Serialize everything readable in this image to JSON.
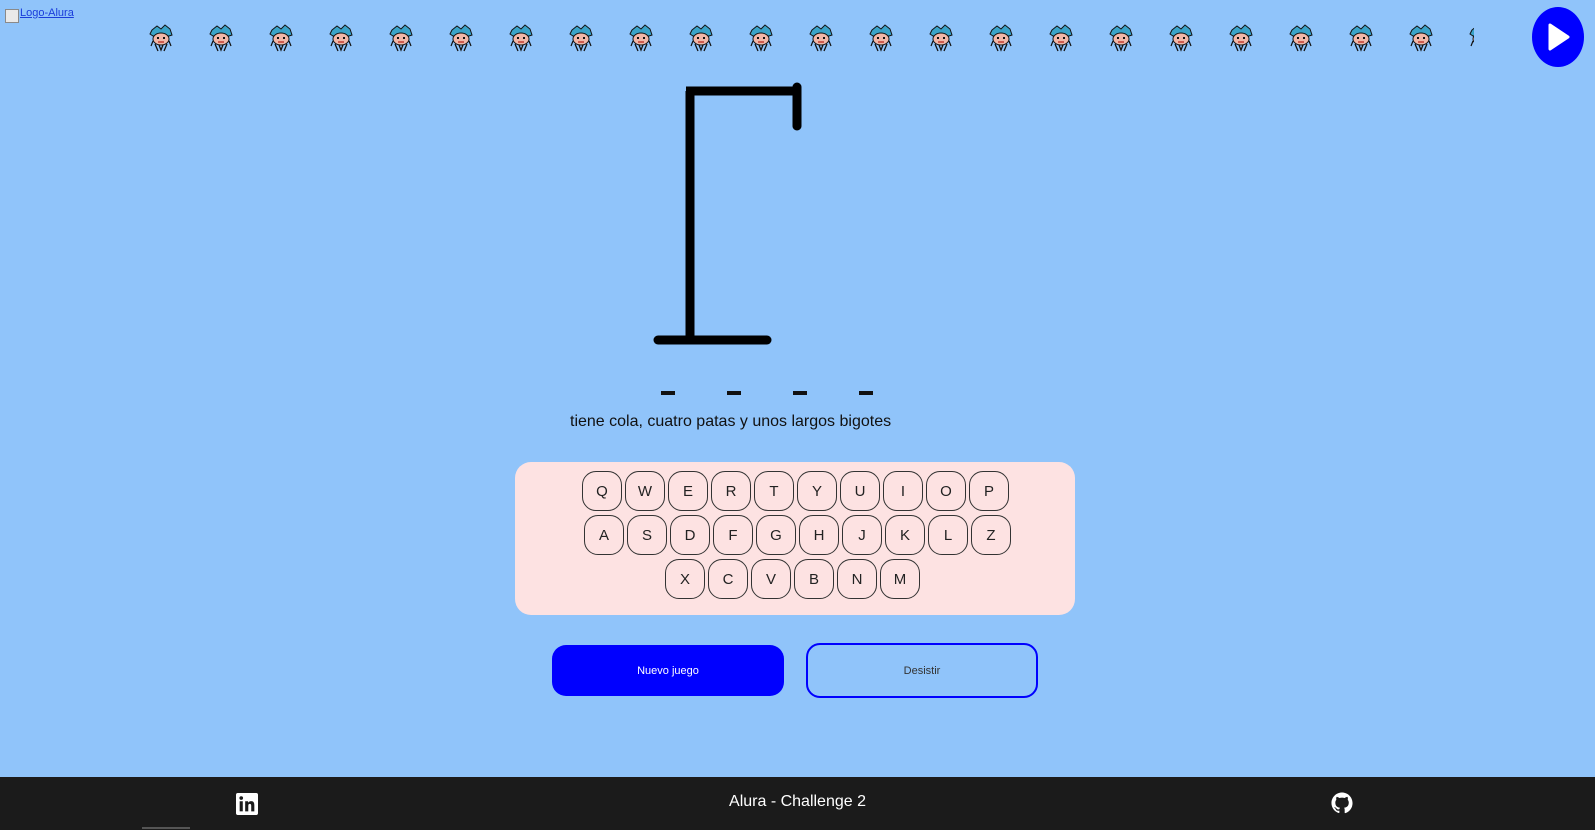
{
  "header": {
    "logo_alt": "Logo-Alura",
    "sprite_icon": "pixel-creature-icon",
    "sprite_count": 23,
    "play_icon": "play-icon"
  },
  "game": {
    "word_slots": [
      "_",
      "_",
      "_",
      "_"
    ],
    "hint": "tiene cola, cuatro patas y unos largos bigotes",
    "keyboard_rows": [
      [
        "Q",
        "W",
        "E",
        "R",
        "T",
        "Y",
        "U",
        "I",
        "O",
        "P"
      ],
      [
        "A",
        "S",
        "D",
        "F",
        "G",
        "H",
        "J",
        "K",
        "L",
        "Z"
      ],
      [
        "X",
        "C",
        "V",
        "B",
        "N",
        "M"
      ]
    ],
    "new_game_label": "Nuevo juego",
    "quit_label": "Desistir"
  },
  "footer": {
    "title": "Alura - Challenge 2",
    "left_icon": "linkedin-icon",
    "right_icon": "github-icon"
  },
  "colors": {
    "background": "#90c4fa",
    "accent": "#0000ff",
    "keyboard_bg": "#fde2e2",
    "footer_bg": "#1b1b1b"
  }
}
